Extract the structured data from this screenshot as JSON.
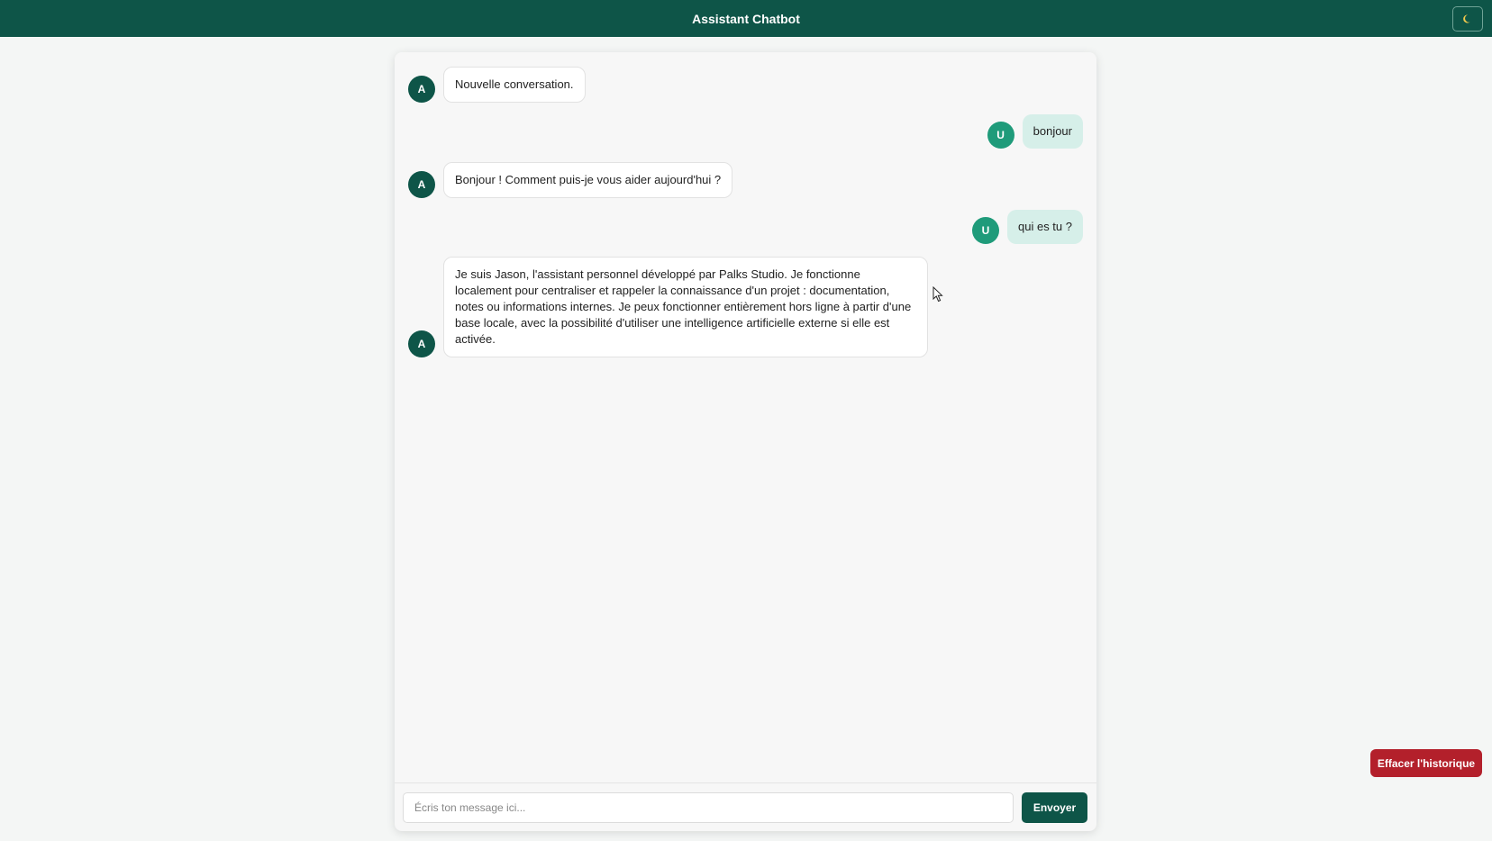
{
  "header": {
    "title": "Assistant Chatbot",
    "theme_toggle_icon": "moon-icon"
  },
  "messages": [
    {
      "role": "bot",
      "avatar": "A",
      "text": "Nouvelle conversation."
    },
    {
      "role": "user",
      "avatar": "U",
      "text": "bonjour"
    },
    {
      "role": "bot",
      "avatar": "A",
      "text": "Bonjour ! Comment puis-je vous aider aujourd'hui ?"
    },
    {
      "role": "user",
      "avatar": "U",
      "text": "qui es tu ?"
    },
    {
      "role": "bot",
      "avatar": "A",
      "text": "Je suis Jason, l'assistant personnel développé par Palks Studio. Je fonctionne localement pour centraliser et rappeler la connaissance d'un projet : documentation, notes ou informations internes. Je peux fonctionner entièrement hors ligne à partir d'une base locale, avec la possibilité d'utiliser une intelligence artificielle externe si elle est activée."
    }
  ],
  "composer": {
    "placeholder": "Écris ton message ici...",
    "value": "",
    "send_label": "Envoyer"
  },
  "actions": {
    "clear_history_label": "Effacer l'historique"
  },
  "colors": {
    "header_bg": "#0e5548",
    "bot_avatar": "#0e5548",
    "user_avatar": "#1f9b7a",
    "user_bubble": "#d6efe9",
    "clear_button": "#b3202b"
  }
}
